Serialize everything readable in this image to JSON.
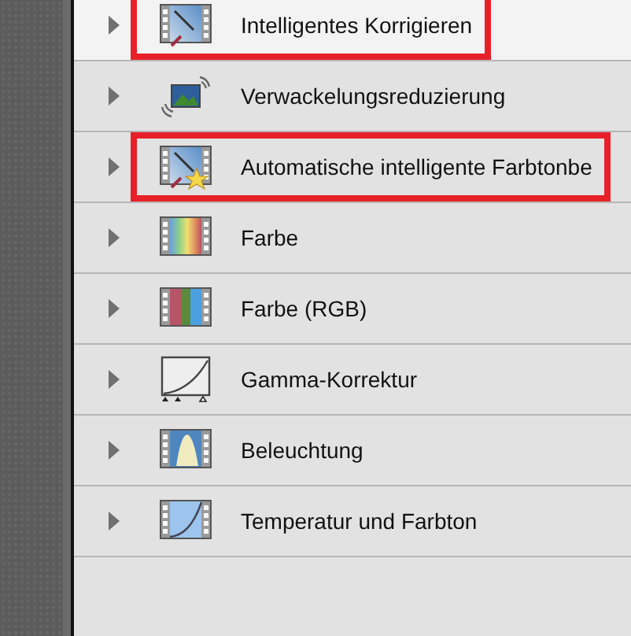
{
  "items": [
    {
      "label": "Intelligentes Korrigieren",
      "expanded": false,
      "selected": true,
      "highlighted": true
    },
    {
      "label": "Verwackelungsreduzierung",
      "expanded": false,
      "selected": false,
      "highlighted": false
    },
    {
      "label": "Automatische intelligente Farbtonbe",
      "expanded": false,
      "selected": false,
      "highlighted": true
    },
    {
      "label": "Farbe",
      "expanded": false,
      "selected": false,
      "highlighted": false
    },
    {
      "label": "Farbe (RGB)",
      "expanded": false,
      "selected": false,
      "highlighted": false
    },
    {
      "label": "Gamma-Korrektur",
      "expanded": false,
      "selected": false,
      "highlighted": false
    },
    {
      "label": "Beleuchtung",
      "expanded": false,
      "selected": false,
      "highlighted": false
    },
    {
      "label": "Temperatur und Farbton",
      "expanded": false,
      "selected": false,
      "highlighted": false
    }
  ]
}
